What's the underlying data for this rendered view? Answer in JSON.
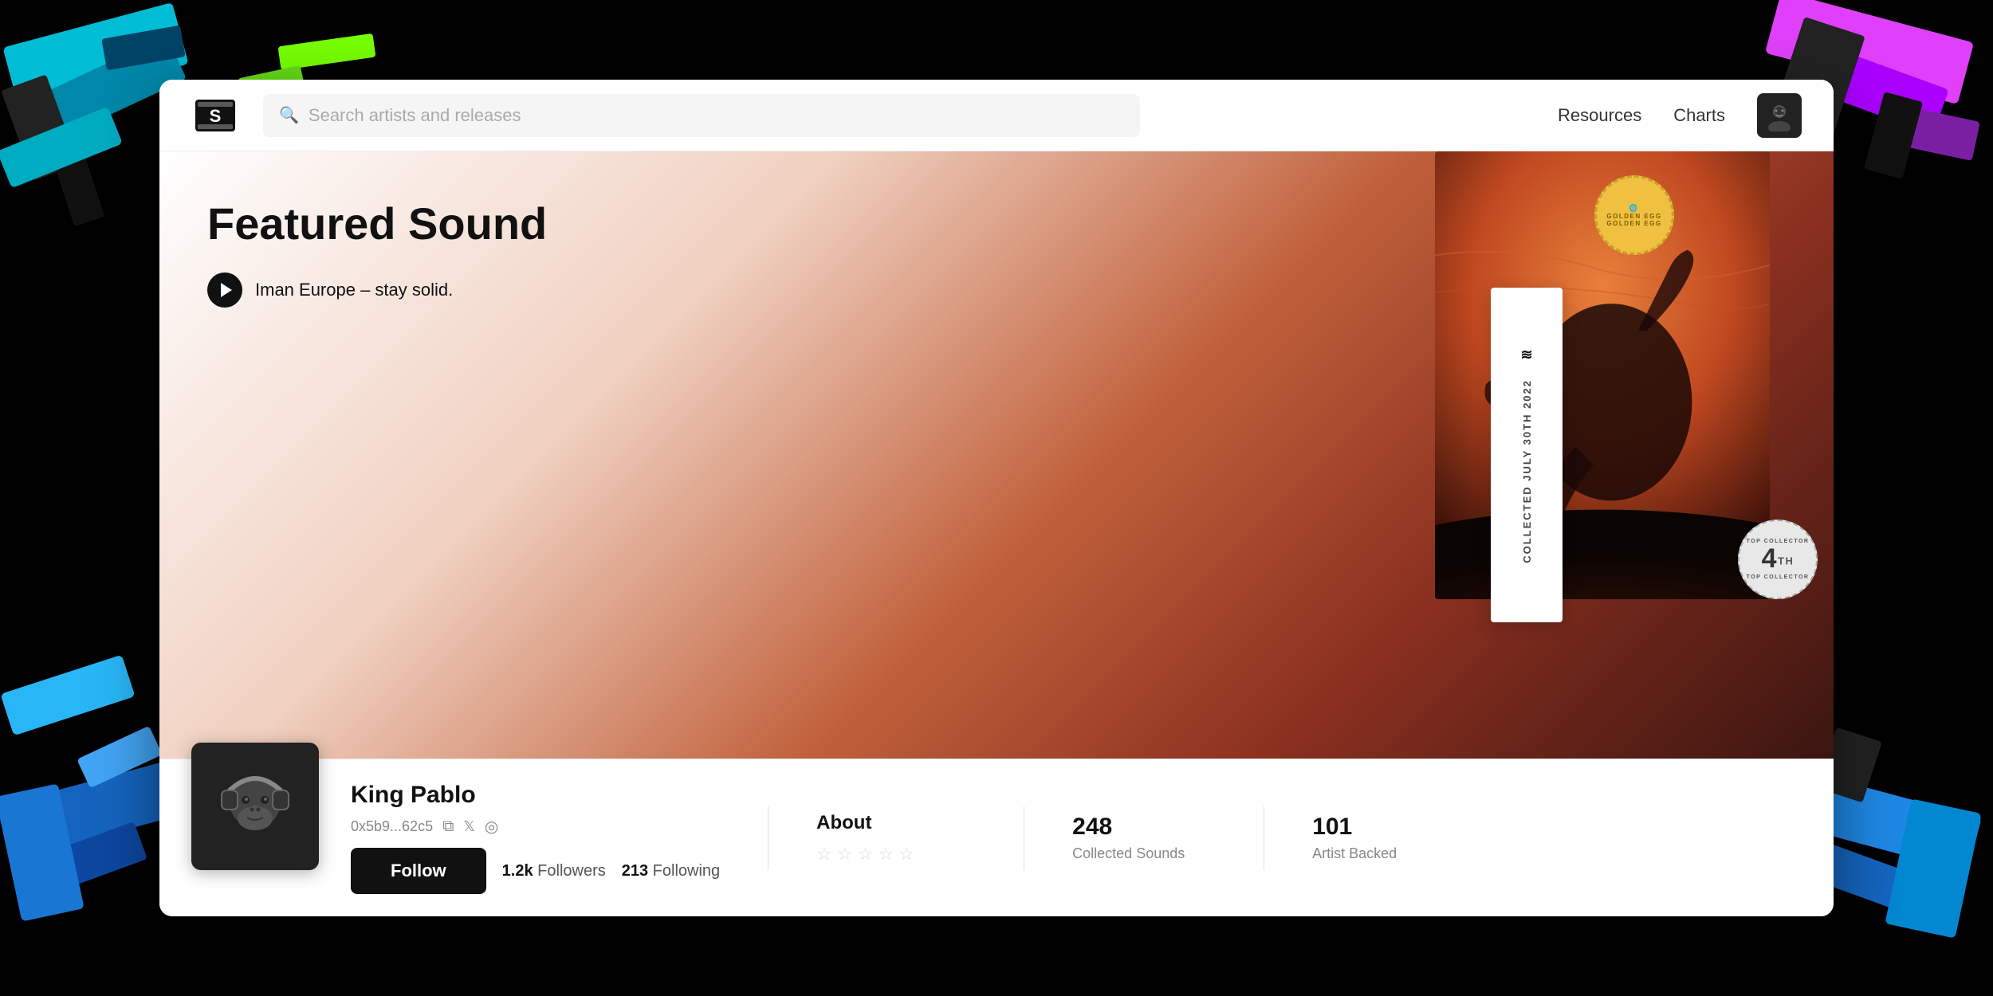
{
  "app": {
    "title": "Sound"
  },
  "navbar": {
    "logo_text": "S",
    "search_placeholder": "Search artists and releases",
    "resources_label": "Resources",
    "charts_label": "Charts"
  },
  "hero": {
    "featured_label": "Featured Sound",
    "track_name": "Iman Europe – stay solid.",
    "collected_date": "COLLECTED JULY 30TH 2022",
    "badge_golden_egg_text": "GOLDEN EGG",
    "badge_globe_icon": "🌐"
  },
  "profile": {
    "name": "King Pablo",
    "address": "0x5b9...62c5",
    "followers_count": "1.2k",
    "followers_label": "Followers",
    "following_count": "213",
    "following_label": "Following",
    "follow_button": "Follow",
    "about_label": "About",
    "collected_sounds_count": "248",
    "collected_sounds_label": "Collected Sounds",
    "artist_backed_count": "101",
    "artist_backed_label": "Artist Backed",
    "top_collector_rank": "4",
    "top_collector_label": "TOP COLLECTOR",
    "stars": [
      "☆",
      "☆",
      "☆",
      "☆",
      "☆"
    ]
  },
  "icons": {
    "search": "🔍",
    "play": "▶",
    "copy": "⧉",
    "twitter": "𝕏",
    "instagram": "◎",
    "avatar": "🦍"
  }
}
